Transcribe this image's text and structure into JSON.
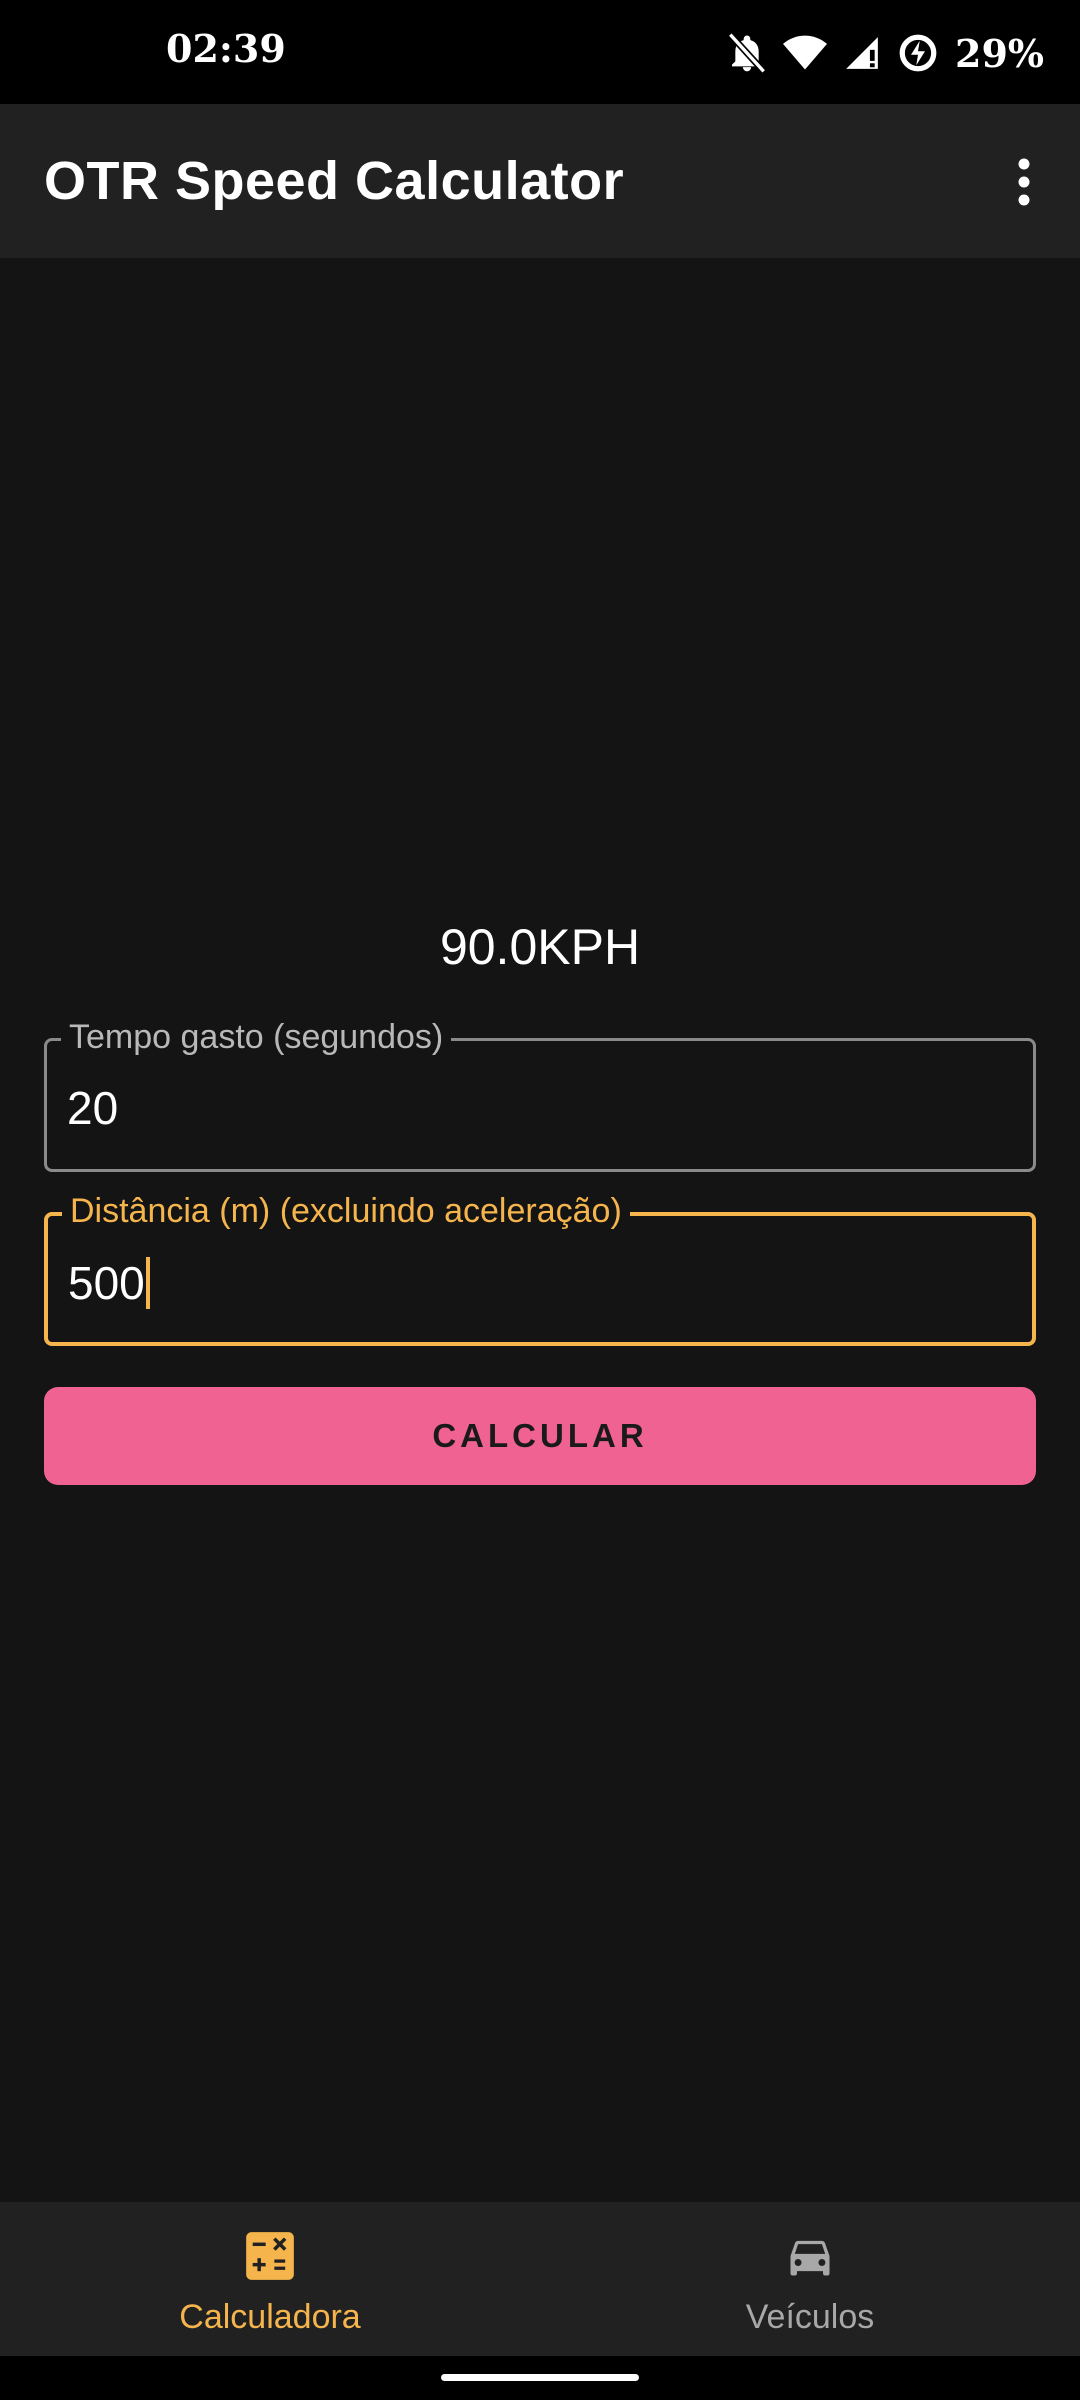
{
  "status_bar": {
    "time": "02:39",
    "battery": "29%",
    "icons": [
      "notifications-off-icon",
      "wifi-icon",
      "signal-icon",
      "battery-saver-icon"
    ]
  },
  "app_bar": {
    "title": "OTR Speed Calculator",
    "overflow_icon": "more-vert-icon"
  },
  "result": {
    "text": "90.0KPH"
  },
  "form": {
    "time_field": {
      "label": "Tempo gasto (segundos)",
      "value": "20"
    },
    "distance_field": {
      "label": "Distância (m) (excluindo aceleração)",
      "value": "500"
    },
    "calculate_button": "CALCULAR"
  },
  "bottom_nav": {
    "items": [
      {
        "label": "Calculadora",
        "icon": "calculator-icon",
        "selected": true
      },
      {
        "label": "Veículos",
        "icon": "car-icon",
        "selected": false
      }
    ]
  },
  "colors": {
    "accent": "#f5b54c",
    "button": "#f06292",
    "background": "#141414",
    "bar": "#212121"
  }
}
